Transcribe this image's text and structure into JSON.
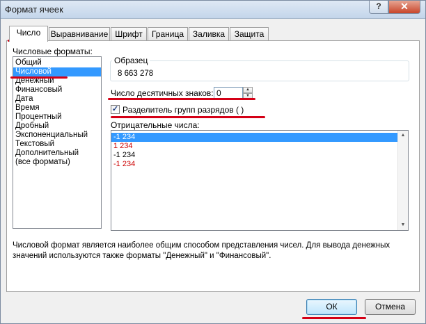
{
  "window": {
    "title": "Формат ячеек",
    "help_label": "?",
    "close_label": "✕"
  },
  "tabs": [
    {
      "label": "Число",
      "active": true
    },
    {
      "label": "Выравнивание"
    },
    {
      "label": "Шрифт"
    },
    {
      "label": "Граница"
    },
    {
      "label": "Заливка"
    },
    {
      "label": "Защита"
    }
  ],
  "formats": {
    "label": "Числовые форматы:",
    "items": [
      "Общий",
      "Числовой",
      "Денежный",
      "Финансовый",
      "Дата",
      "Время",
      "Процентный",
      "Дробный",
      "Экспоненциальный",
      "Текстовый",
      "Дополнительный",
      "(все форматы)"
    ],
    "selected": "Числовой"
  },
  "sample": {
    "label": "Образец",
    "value": "8 663 278"
  },
  "decimals": {
    "label": "Число десятичных знаков:",
    "value": "0"
  },
  "separator": {
    "label": "Разделитель групп разрядов ( )",
    "checked": true
  },
  "negative": {
    "label": "Отрицательные числа:",
    "items": [
      "-1 234",
      "1 234",
      "-1 234",
      "-1 234"
    ],
    "colors": [
      "#ffffff",
      "#cc0000",
      "#000000",
      "#cc0000"
    ],
    "selected_index": 0
  },
  "description": "Числовой формат является наиболее общим способом представления чисел. Для вывода денежных значений используются также форматы \"Денежный\" и \"Финансовый\".",
  "buttons": {
    "ok": "ОК",
    "cancel": "Отмена"
  },
  "annotation_color": "#d40016"
}
